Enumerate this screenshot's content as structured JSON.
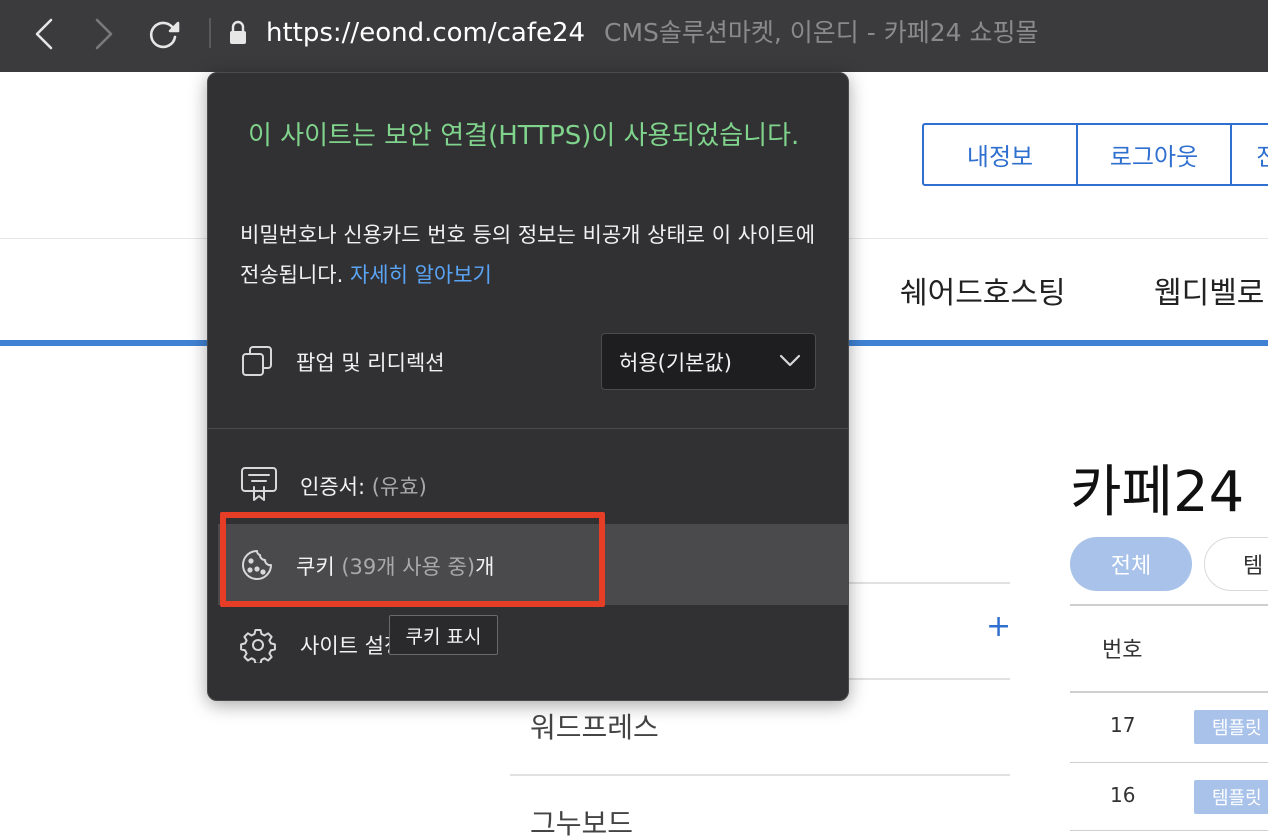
{
  "browser": {
    "back_icon": "chevron-left-icon",
    "forward_icon": "chevron-right-icon",
    "reload_icon": "reload-icon",
    "lock_icon": "lock-icon",
    "url": "https://eond.com/cafe24",
    "page_title": "CMS솔루션마켓, 이온디 - 카페24 쇼핑몰"
  },
  "page": {
    "top_buttons": [
      "내정보",
      "로그아웃",
      "진"
    ],
    "menu": [
      "쉐어드호스팅",
      "웹디벨로"
    ],
    "sidebar": [
      "워드프레스",
      "그누보드"
    ],
    "plus_label": "+",
    "heading": "카페24",
    "filters": [
      "전체",
      "템"
    ],
    "table_header_num": "번호",
    "rows": [
      {
        "num": "17",
        "badge": "템플릿"
      },
      {
        "num": "16",
        "badge": "템플릿"
      }
    ]
  },
  "popup": {
    "title": "이 사이트는 보안 연결(HTTPS)이 사용되었습니다.",
    "description": "비밀번호나 신용카드 번호 등의 정보는 비공개 상태로 이 사이트에 전송됩니다. ",
    "learn_more": "자세히 알아보기",
    "popups_label": "팝업 및 리디렉션",
    "popups_value": "허용(기본값)",
    "certificate_label": "인증서:",
    "certificate_status": "(유효)",
    "cookies_label": "쿠키",
    "cookies_count": "(39개 사용 중)",
    "cookies_suffix": "개",
    "site_settings_label": "사이트 설정",
    "tooltip": "쿠키 표시"
  },
  "colors": {
    "toolbar": "#3b3b3d",
    "popup_bg": "#313133",
    "secure_green": "#7fd38c",
    "link_blue": "#5aa4f5",
    "highlight_red": "#e63d27",
    "brand_blue": "#2f6fcf"
  }
}
